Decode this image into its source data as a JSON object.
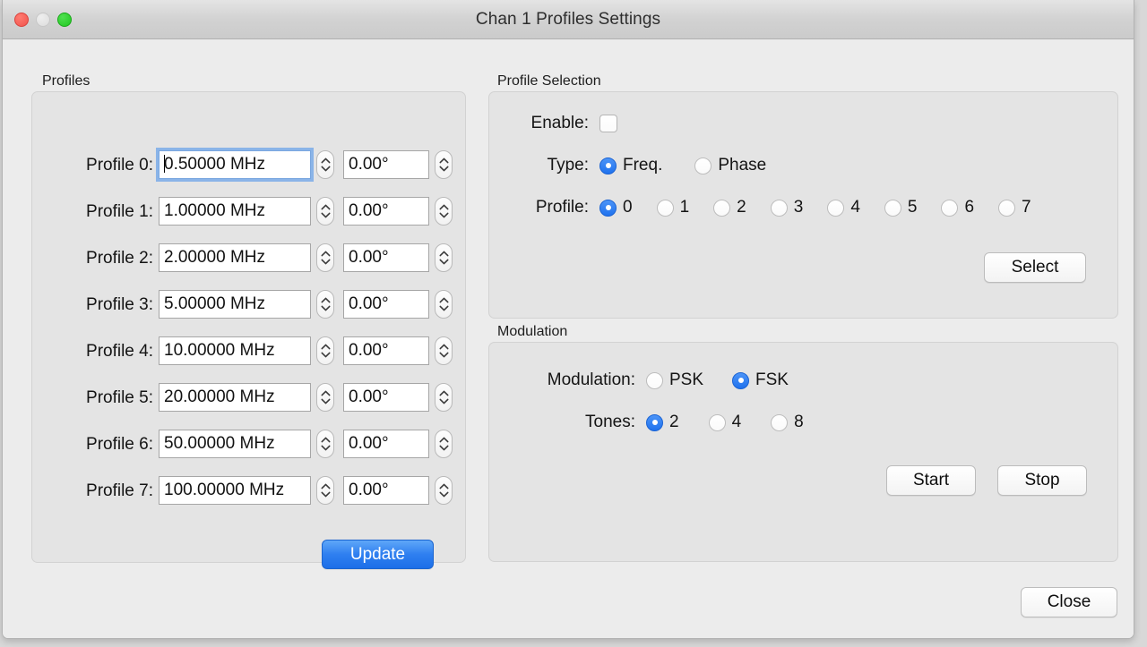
{
  "window": {
    "title": "Chan 1 Profiles Settings",
    "traffic_lights": [
      "close-button",
      "minimize-button",
      "zoom-button"
    ],
    "accent_color": "#2f7ff0"
  },
  "profiles_group": {
    "title": "Profiles",
    "rows": [
      {
        "label": "Profile 0:",
        "frequency": "0.50000 MHz",
        "phase": "0.00°",
        "focused": true
      },
      {
        "label": "Profile 1:",
        "frequency": "1.00000 MHz",
        "phase": "0.00°",
        "focused": false
      },
      {
        "label": "Profile 2:",
        "frequency": "2.00000 MHz",
        "phase": "0.00°",
        "focused": false
      },
      {
        "label": "Profile 3:",
        "frequency": "5.00000 MHz",
        "phase": "0.00°",
        "focused": false
      },
      {
        "label": "Profile 4:",
        "frequency": "10.00000 MHz",
        "phase": "0.00°",
        "focused": false
      },
      {
        "label": "Profile 5:",
        "frequency": "20.00000 MHz",
        "phase": "0.00°",
        "focused": false
      },
      {
        "label": "Profile 6:",
        "frequency": "50.00000 MHz",
        "phase": "0.00°",
        "focused": false
      },
      {
        "label": "Profile 7:",
        "frequency": "100.00000 MHz",
        "phase": "0.00°",
        "focused": false
      }
    ],
    "update_button": "Update"
  },
  "profile_selection": {
    "title": "Profile Selection",
    "enable_label": "Enable:",
    "enable_checked": false,
    "type_label": "Type:",
    "type_options": [
      "Freq.",
      "Phase"
    ],
    "type_selected": "Freq.",
    "profile_label": "Profile:",
    "profile_options": [
      "0",
      "1",
      "2",
      "3",
      "4",
      "5",
      "6",
      "7"
    ],
    "profile_selected": "0",
    "select_button": "Select"
  },
  "modulation": {
    "title": "Modulation",
    "modulation_label": "Modulation:",
    "modulation_options": [
      "PSK",
      "FSK"
    ],
    "modulation_selected": "FSK",
    "tones_label": "Tones:",
    "tones_options": [
      "2",
      "4",
      "8"
    ],
    "tones_selected": "2",
    "start_button": "Start",
    "stop_button": "Stop"
  },
  "footer": {
    "close_button": "Close"
  }
}
